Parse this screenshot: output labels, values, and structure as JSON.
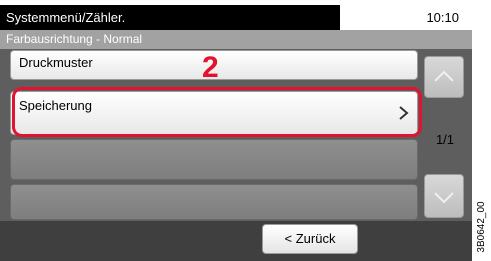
{
  "header": {
    "title": "Systemmenü/Zähler.",
    "time": "10:10"
  },
  "subheader": {
    "title": "Farbausrichtung - Normal"
  },
  "list": {
    "items": [
      {
        "label": "Druckmuster"
      },
      {
        "label": "Speicherung"
      },
      {
        "label": ""
      },
      {
        "label": ""
      }
    ],
    "page_indicator": "1/1"
  },
  "callout": {
    "step_number": "2"
  },
  "footer": {
    "back_label": "< Zurück"
  },
  "figure_code": "3B0642_00",
  "colors": {
    "highlight": "#e3122e",
    "screen_bg": "#5e5e5e",
    "bottom_bar": "#3f3f3f"
  },
  "icons": {
    "scroll_up": "chevron-up-icon",
    "scroll_down": "chevron-down-icon",
    "row_open": "chevron-right-icon"
  }
}
